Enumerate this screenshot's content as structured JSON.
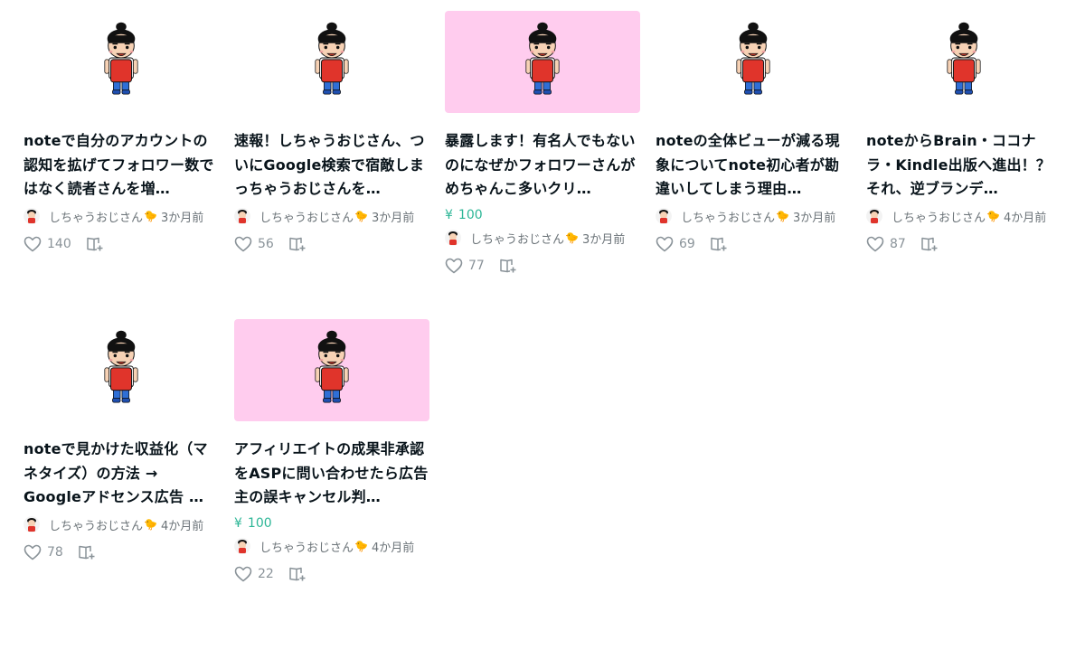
{
  "colors": {
    "accent": "#2cb696",
    "thumb_pink": "#ffccee",
    "text": "#08131a",
    "muted": "#6b7378"
  },
  "icons": {
    "like": "heart-outline-icon",
    "magazine": "magazine-add-icon",
    "badge": "chick-icon"
  },
  "cards": [
    {
      "title": "noteで自分のアカウントの認知を拡げてフォロワー数ではなく読者さんを増…",
      "price": "",
      "author": "しちゃうおじさん",
      "date": "3か月前",
      "likes": "140",
      "thumb": "white"
    },
    {
      "title": "速報！しちゃうおじさん、ついにGoogle検索で宿敵しまっちゃうおじさんを…",
      "price": "",
      "author": "しちゃうおじさん",
      "date": "3か月前",
      "likes": "56",
      "thumb": "white"
    },
    {
      "title": "暴露します！有名人でもないのになぜかフォロワーさんがめちゃんこ多いクリ…",
      "price": "100",
      "author": "しちゃうおじさん",
      "date": "3か月前",
      "likes": "77",
      "thumb": "pink"
    },
    {
      "title": "noteの全体ビューが減る現象についてnote初心者が勘違いしてしまう理由…",
      "price": "",
      "author": "しちゃうおじさん",
      "date": "3か月前",
      "likes": "69",
      "thumb": "white"
    },
    {
      "title": "noteからBrain・ココナラ・Kindle出版へ進出！？それ、逆ブランデ…",
      "price": "",
      "author": "しちゃうおじさん",
      "date": "4か月前",
      "likes": "87",
      "thumb": "white"
    },
    {
      "title": "noteで見かけた収益化（マネタイズ）の方法 → Googleアドセンス広告 …",
      "price": "",
      "author": "しちゃうおじさん",
      "date": "4か月前",
      "likes": "78",
      "thumb": "white"
    },
    {
      "title": "アフィリエイトの成果非承認をASPに問い合わせたら広告主の誤キャンセル判…",
      "price": "100",
      "author": "しちゃうおじさん",
      "date": "4か月前",
      "likes": "22",
      "thumb": "pink"
    }
  ]
}
